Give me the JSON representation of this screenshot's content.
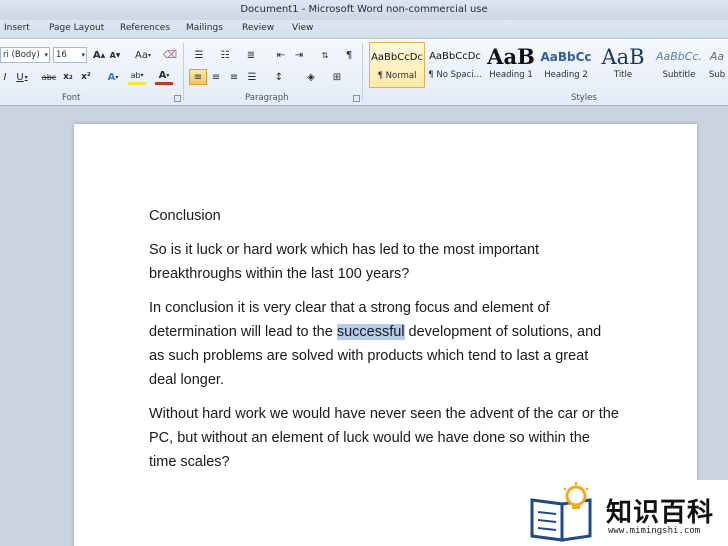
{
  "window": {
    "title": "Document1  -  Microsoft Word non-commercial use"
  },
  "tabs": [
    "Insert",
    "Page Layout",
    "References",
    "Mailings",
    "Review",
    "View"
  ],
  "font_group": {
    "label": "Font",
    "font_name": "ri (Body)",
    "font_size": "16",
    "grow_label": "A",
    "shrink_label": "A",
    "case_label": "Aa",
    "italic": "I",
    "underline": "U",
    "strike": "abc",
    "subscript": "x₂",
    "superscript": "x²",
    "effects": "A",
    "highlight": "ab",
    "font_color": "A"
  },
  "paragraph_group": {
    "label": "Paragraph",
    "pilcrow": "¶"
  },
  "styles_group": {
    "label": "Styles",
    "items": [
      {
        "preview": "AaBbCcDc",
        "name": "¶ Normal"
      },
      {
        "preview": "AaBbCcDc",
        "name": "¶ No Spaci..."
      },
      {
        "preview": "AaB",
        "name": "Heading 1"
      },
      {
        "preview": "AaBbCc",
        "name": "Heading 2"
      },
      {
        "preview": "AaB",
        "name": "Title"
      },
      {
        "preview": "AaBbCc.",
        "name": "Subtitle"
      },
      {
        "preview": "Aa",
        "name": "Sub"
      }
    ]
  },
  "document": {
    "heading": "Conclusion",
    "p1": "So is it luck or hard work which has led to the most important breakthroughs within the last 100 years?",
    "p2_before": "In conclusion it is very clear that a strong focus and element of determination will lead to the ",
    "p2_selected": "successful",
    "p2_after": " development of solutions, and as such problems are solved with products which tend to last a great deal longer.",
    "p3": "Without hard work we would have never seen the advent of the car or the PC, but without an element of luck would we have done so within the time scales?"
  },
  "watermark": {
    "text": "知识百科",
    "url": "www.mimingshi.com"
  },
  "colors": {
    "accent": "#f6c55b",
    "selection": "#b6cbea",
    "ribbon": "#e3ebf5"
  }
}
